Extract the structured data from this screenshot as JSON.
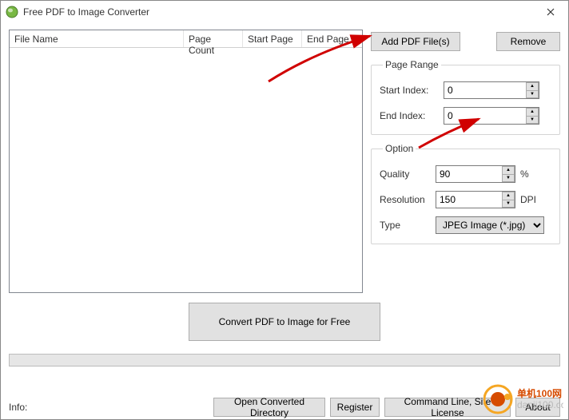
{
  "window": {
    "title": "Free PDF to Image Converter"
  },
  "grid": {
    "cols": {
      "filename": "File Name",
      "pagecount": "Page Count",
      "startpage": "Start Page",
      "endpage": "End Page"
    }
  },
  "buttons": {
    "add": "Add PDF File(s)",
    "remove": "Remove",
    "convert": "Convert PDF to Image for Free",
    "ocd": "Open Converted Directory",
    "register": "Register",
    "cmdline": "Command Line, Site License",
    "about": "About"
  },
  "groups": {
    "pageRange": "Page Range",
    "option": "Option"
  },
  "labels": {
    "startIndex": "Start Index:",
    "endIndex": "End Index:",
    "quality": "Quality",
    "resolution": "Resolution",
    "type": "Type",
    "info": "Info:",
    "pct": "%",
    "dpi": "DPI"
  },
  "values": {
    "startIndex": "0",
    "endIndex": "0",
    "quality": "90",
    "resolution": "150",
    "type": "JPEG Image (*.jpg)"
  }
}
